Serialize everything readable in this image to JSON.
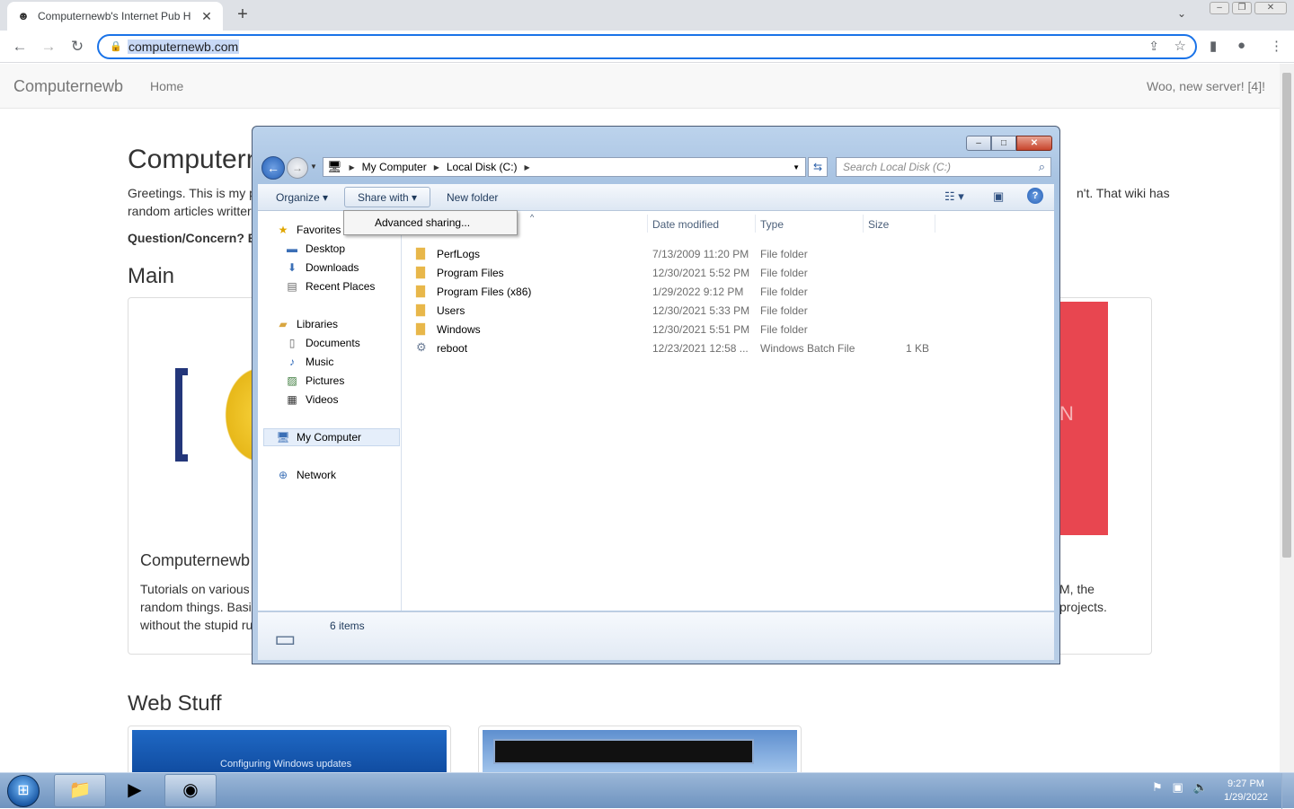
{
  "browser": {
    "tab_title": "Computernewb's Internet Pub H",
    "tab_close": "✕",
    "new_tab": "+",
    "url": "computernewb.com"
  },
  "site": {
    "brand": "Computernewb",
    "nav_home": "Home",
    "nav_right": "Woo, new server! [4]!",
    "heading": "Computern",
    "intro_line1": "Greetings. This is my p",
    "intro_line2": "random articles writter",
    "intro_right": "n't. That wiki has",
    "question": "Question/Concern? E",
    "main_heading": "Main",
    "card_title": "Computernewb",
    "card_text1": "Tutorials on various",
    "card_text2": "random things. Basi",
    "card_text3": "without the stupid ru",
    "card_right1": "M, the",
    "card_right2": "projects.",
    "web_heading": "Web Stuff",
    "thumb1_text": "Configuring Windows updates"
  },
  "explorer": {
    "breadcrumb": [
      "My Computer",
      "Local Disk (C:)"
    ],
    "search_placeholder": "Search Local Disk (C:)",
    "organize": "Organize",
    "share_with": "Share with",
    "new_folder": "New folder",
    "menu_item": "Advanced sharing...",
    "columns": {
      "date": "Date modified",
      "type": "Type",
      "size": "Size"
    },
    "nav": {
      "favorites": "Favorites",
      "desktop": "Desktop",
      "downloads": "Downloads",
      "recent": "Recent Places",
      "libraries": "Libraries",
      "documents": "Documents",
      "music": "Music",
      "pictures": "Pictures",
      "videos": "Videos",
      "mycomputer": "My Computer",
      "network": "Network"
    },
    "files": [
      {
        "name": "PerfLogs",
        "date": "7/13/2009 11:20 PM",
        "type": "File folder",
        "size": ""
      },
      {
        "name": "Program Files",
        "date": "12/30/2021 5:52 PM",
        "type": "File folder",
        "size": ""
      },
      {
        "name": "Program Files (x86)",
        "date": "1/29/2022 9:12 PM",
        "type": "File folder",
        "size": ""
      },
      {
        "name": "Users",
        "date": "12/30/2021 5:33 PM",
        "type": "File folder",
        "size": ""
      },
      {
        "name": "Windows",
        "date": "12/30/2021 5:51 PM",
        "type": "File folder",
        "size": ""
      },
      {
        "name": "reboot",
        "date": "12/23/2021 12:58 ...",
        "type": "Windows Batch File",
        "size": "1 KB"
      }
    ],
    "status": "6 items"
  },
  "taskbar": {
    "time": "9:27 PM",
    "date": "1/29/2022"
  }
}
